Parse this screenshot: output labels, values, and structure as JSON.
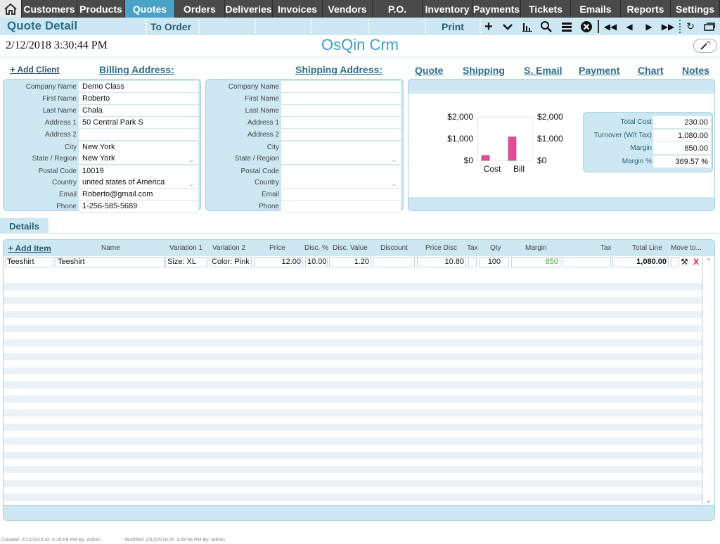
{
  "nav": {
    "home_icon": "home-icon",
    "tabs": [
      {
        "label": "Customers",
        "w": 79
      },
      {
        "label": "Products",
        "w": 68
      },
      {
        "label": "Quotes",
        "w": 71
      },
      {
        "label": "Orders",
        "w": 71
      },
      {
        "label": "Deliveries",
        "w": 68
      },
      {
        "label": "Invoices",
        "w": 71
      },
      {
        "label": "Vendors",
        "w": 71
      },
      {
        "label": "P.O.",
        "w": 71
      },
      {
        "label": "Inventory",
        "w": 71
      },
      {
        "label": "Payments",
        "w": 69
      },
      {
        "label": "Tickets",
        "w": 71
      },
      {
        "label": "Emails",
        "w": 71
      },
      {
        "label": "Reports",
        "w": 71
      },
      {
        "label": "Settings",
        "w": 70
      }
    ],
    "active": "Quotes"
  },
  "toolbar": {
    "title": "Quote Detail",
    "to_order": "To Order",
    "print": "Print"
  },
  "datetime": "2/12/2018 3:30:44 PM",
  "app_name": "OsQin Crm",
  "links": {
    "add_client": "Add Client",
    "billing": "Billing Address:",
    "shipping": "Shipping Address:",
    "quote": "Quote",
    "shipping_tab": "Shipping",
    "s_email": "S. Email",
    "payment": "Payment",
    "chart": "Chart",
    "notes": "Notes"
  },
  "billing": {
    "labels": [
      "Company Name",
      "First Name",
      "Last Name",
      "Address 1",
      "Address 2",
      "City",
      "State / Region",
      "Postal Code",
      "Country",
      "Email",
      "Phone"
    ],
    "values": [
      "Demo Class",
      "Roberto",
      "Chala",
      "50 Central Park S",
      "",
      "New York",
      "New York",
      "10019",
      "united states of America",
      "Roberto@gmail.com",
      "1-256-585-5689"
    ]
  },
  "shipping": {
    "labels": [
      "Company Name",
      "First Name",
      "Last Name",
      "Address 1",
      "Address 2",
      "City",
      "State / Region",
      "Postal Code",
      "Country",
      "Email",
      "Phone"
    ],
    "values": [
      "",
      "",
      "",
      "",
      "",
      "",
      "",
      "",
      "",
      "",
      ""
    ]
  },
  "chart_data": {
    "type": "bar",
    "categories": [
      "Cost",
      "Bill"
    ],
    "values": [
      230,
      1080
    ],
    "ylim": [
      0,
      2000
    ],
    "ytick_labels": [
      "$2,000",
      "$1,000",
      "$0"
    ],
    "color": "#e8489a"
  },
  "stats": {
    "labels": [
      "Total Cost",
      "Turnover (W/t Tax)",
      "Margin",
      "Margin  %"
    ],
    "values": [
      "230.00",
      "1,080.00",
      "850.00",
      "369.57 %"
    ]
  },
  "details": {
    "tab_label": "Details",
    "add_item": "Add Item",
    "columns": [
      "Name",
      "Variation 1",
      "Variation 2",
      "Price",
      "Disc. %",
      "Disc. Value",
      "Discount",
      "Price Disc",
      "Tax",
      "Qty",
      "Margin",
      "Tax",
      "Total Line",
      "Move to..."
    ],
    "row": {
      "code": "Teeshirt",
      "name": "Teeshirt",
      "var1": "Size: XL",
      "var2": "Color: Pink",
      "price": "12.00",
      "disc_pct": "10.00",
      "disc_val": "1.20",
      "discount": "",
      "price_disc": "10.80",
      "qty": "100",
      "margin": "850",
      "tax": "",
      "total": "1,080.00",
      "delete": "X"
    }
  },
  "footer": {
    "created": "Created: 2/12/2018   At:  3:26:09 PM  By: Admin",
    "modified": "Modified: 2/12/2018   At:  3:28:58 PM  By: Admin"
  },
  "colors": {
    "accent": "#4aa3c7",
    "nav_bg": "#4a4a4a",
    "panel_bg": "#cde8f3",
    "title": "#2b6e91",
    "bar": "#e8489a",
    "margin_green": "#3aaa35",
    "delete_red": "#e02020"
  }
}
